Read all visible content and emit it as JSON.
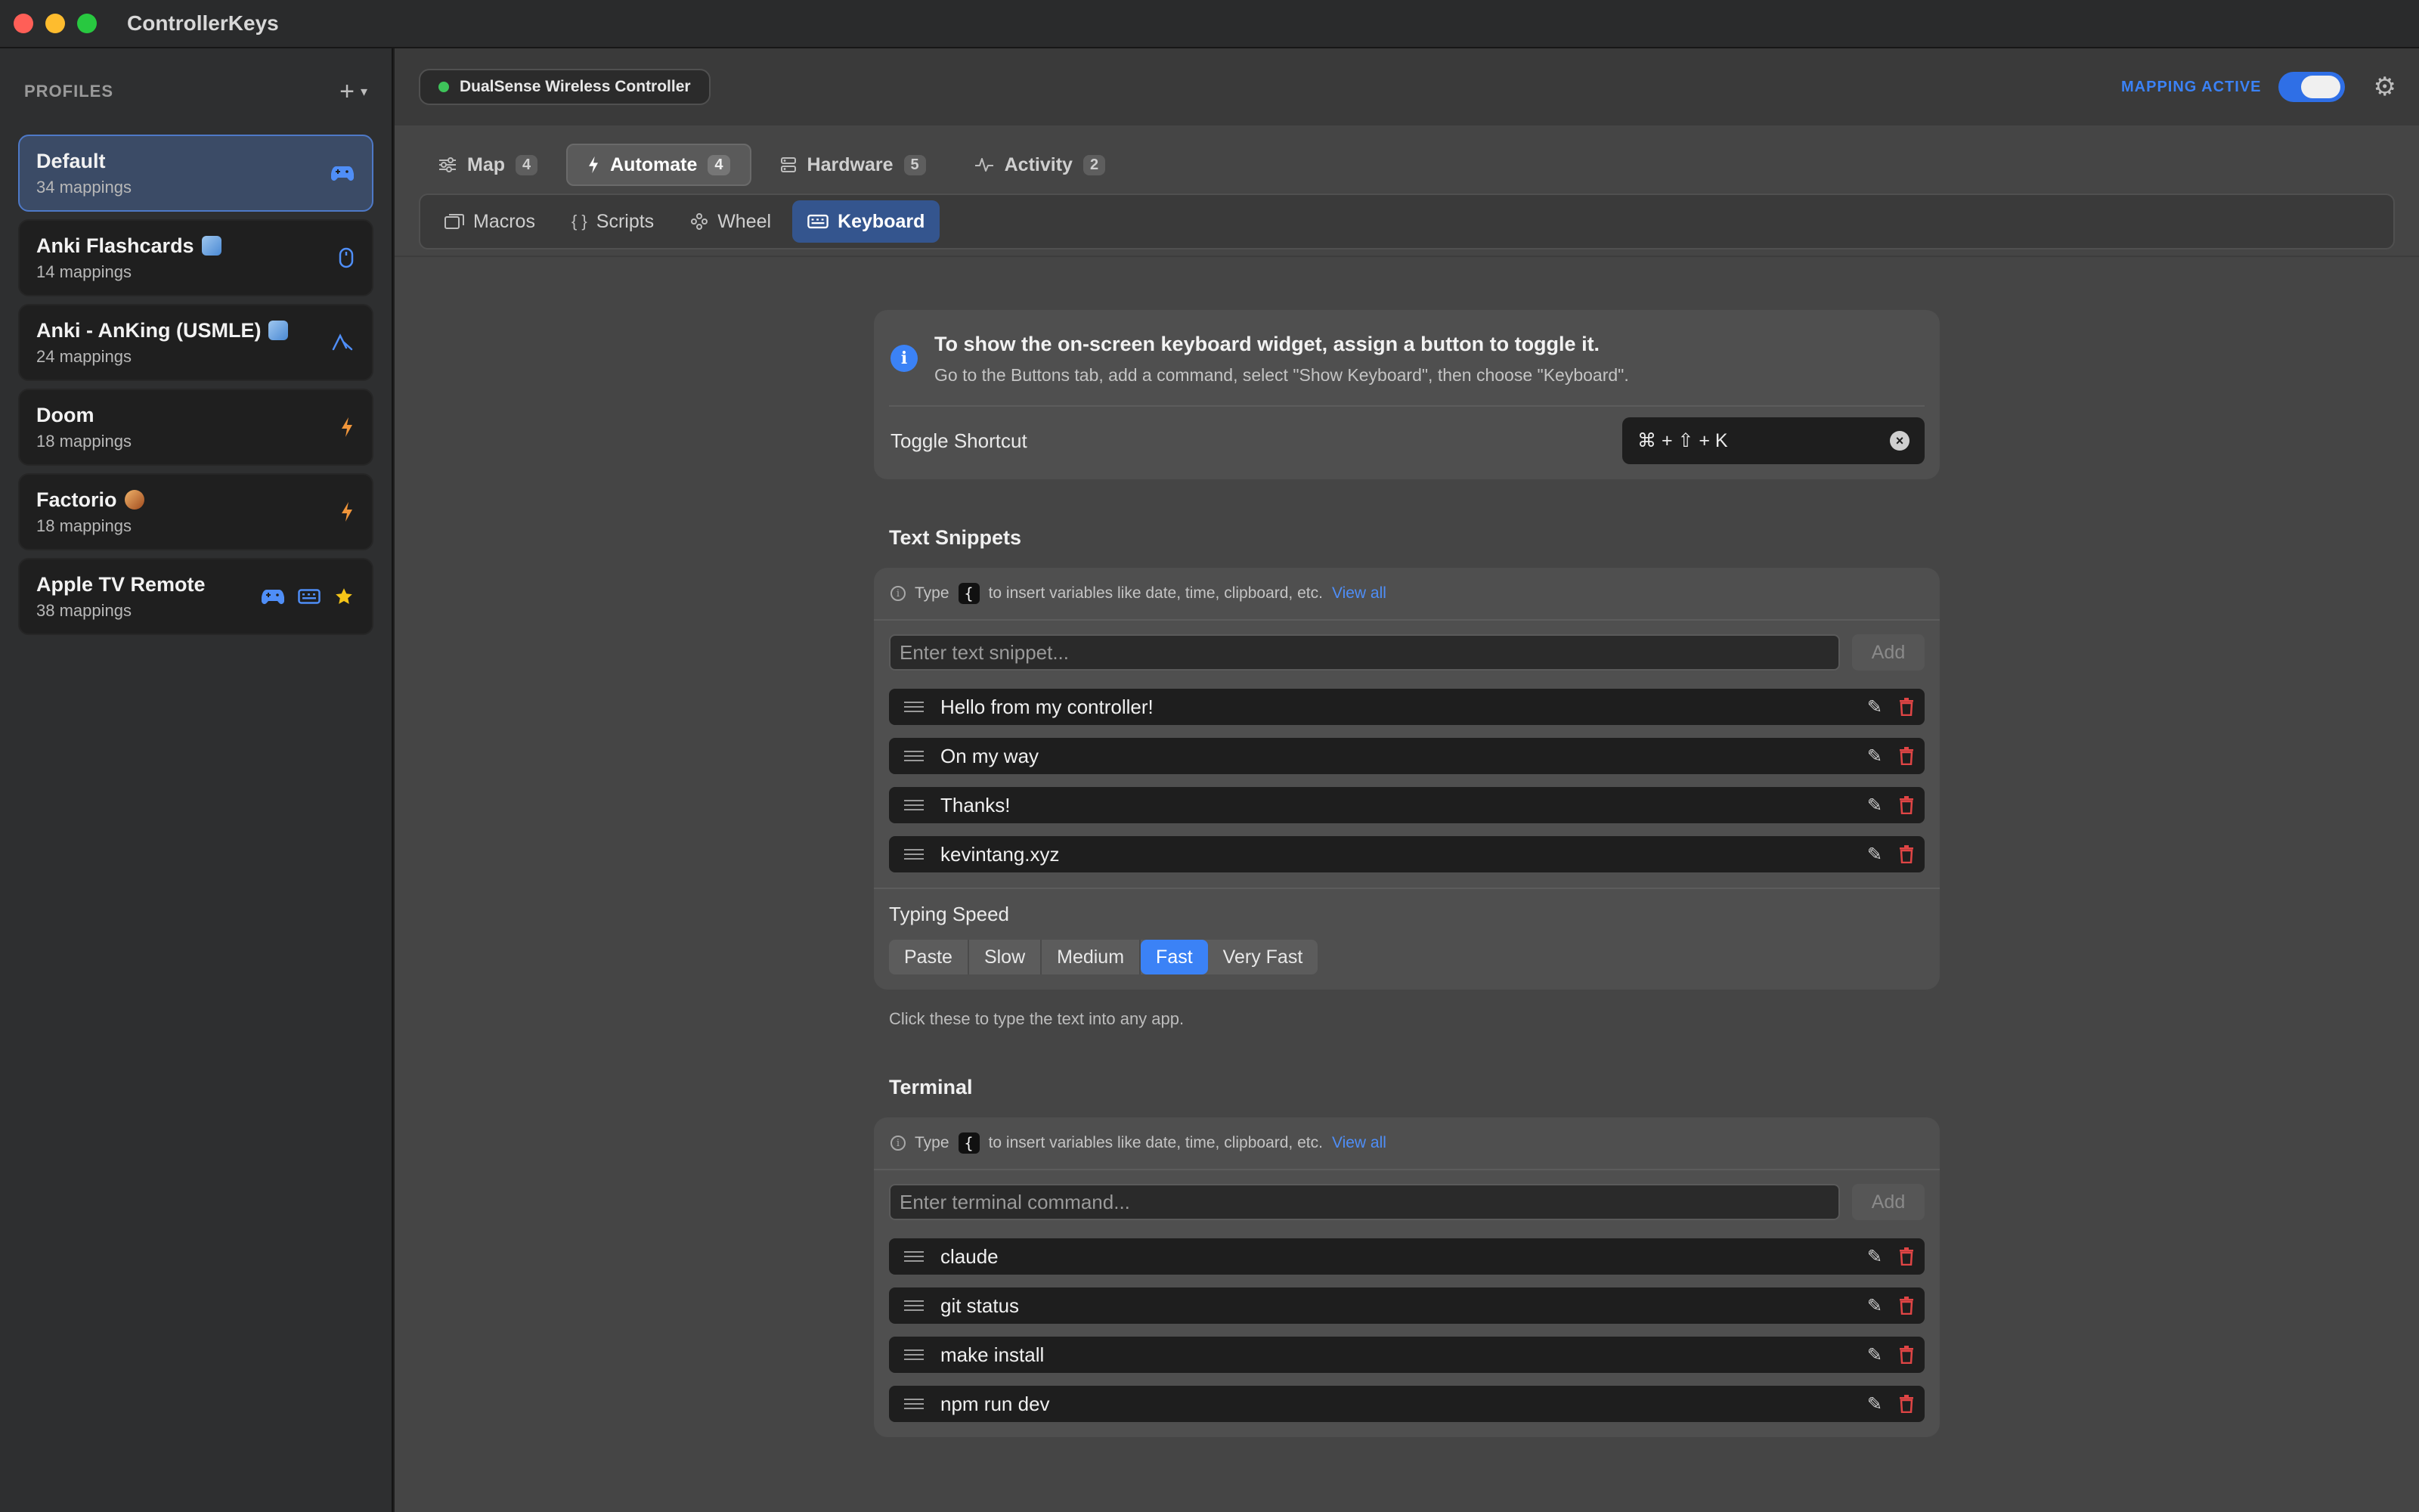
{
  "window": {
    "title": "ControllerKeys"
  },
  "sidebar": {
    "title": "PROFILES",
    "add_symbol": "+",
    "profiles": [
      {
        "name": "Default",
        "count": "34 mappings",
        "active": true,
        "icons": [
          "gamepad-icon"
        ]
      },
      {
        "name": "Anki Flashcards",
        "count": "14 mappings",
        "icons": [
          "mouse-icon"
        ]
      },
      {
        "name": "Anki - AnKing (USMLE)",
        "count": "24 mappings",
        "icons": [
          "gesture-icon"
        ]
      },
      {
        "name": "Doom",
        "count": "18 mappings",
        "icons": [
          "bolt-icon"
        ]
      },
      {
        "name": "Factorio",
        "count": "18 mappings",
        "icons": [
          "bolt-icon"
        ]
      },
      {
        "name": "Apple TV Remote",
        "count": "38 mappings",
        "icons": [
          "gamepad-icon",
          "keyboard-icon",
          "star-icon"
        ]
      }
    ]
  },
  "topbar": {
    "device": "DualSense Wireless Controller",
    "mapping_label": "MAPPING ACTIVE",
    "mapping_active": true
  },
  "tabs": [
    {
      "label": "Map",
      "count": "4"
    },
    {
      "label": "Automate",
      "count": "4",
      "active": true
    },
    {
      "label": "Hardware",
      "count": "5"
    },
    {
      "label": "Activity",
      "count": "2"
    }
  ],
  "subtabs": [
    {
      "label": "Macros"
    },
    {
      "label": "Scripts"
    },
    {
      "label": "Wheel"
    },
    {
      "label": "Keyboard",
      "active": true
    }
  ],
  "info": {
    "title": "To show the on-screen keyboard widget, assign a button to toggle it.",
    "subtitle": "Go to the Buttons tab, add a command, select \"Show Keyboard\", then choose \"Keyboard\".",
    "shortcut_label": "Toggle Shortcut",
    "shortcut_value": "⌘ + ⇧ + K"
  },
  "snippets": {
    "title": "Text Snippets",
    "hint_pre": "Type",
    "hint_key": "{",
    "hint_post": "to insert variables like date, time, clipboard, etc.",
    "hint_link": "View all",
    "placeholder": "Enter text snippet...",
    "add_label": "Add",
    "items": [
      "Hello from my controller!",
      "On my way",
      "Thanks!",
      "kevintang.xyz"
    ],
    "speed_label": "Typing Speed",
    "speeds": [
      "Paste",
      "Slow",
      "Medium",
      "Fast",
      "Very Fast"
    ],
    "speed_selected": "Fast",
    "note": "Click these to type the text into any app."
  },
  "terminal": {
    "title": "Terminal",
    "hint_pre": "Type",
    "hint_key": "{",
    "hint_post": "to insert variables like date, time, clipboard, etc.",
    "hint_link": "View all",
    "placeholder": "Enter terminal command...",
    "add_label": "Add",
    "items": [
      "claude",
      "git status",
      "make install",
      "npm run dev"
    ]
  },
  "colors": {
    "accent": "#3b82f6",
    "danger": "#e04545",
    "status_green": "#3ec45a"
  }
}
